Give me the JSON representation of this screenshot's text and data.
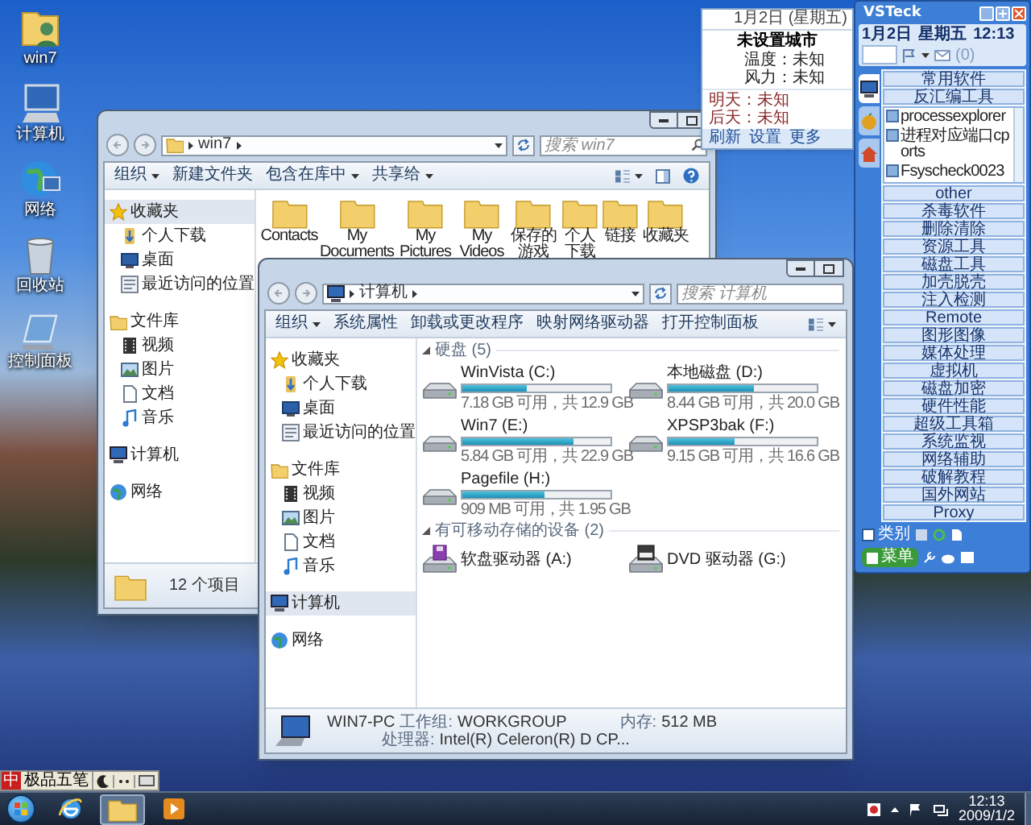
{
  "desktop_icons": [
    {
      "label": "win7",
      "kind": "user"
    },
    {
      "label": "计算机",
      "kind": "computer"
    },
    {
      "label": "网络",
      "kind": "network"
    },
    {
      "label": "回收站",
      "kind": "recycle"
    },
    {
      "label": "控制面板",
      "kind": "control"
    }
  ],
  "folder_window": {
    "breadcrumb": [
      "win7"
    ],
    "search": {
      "placeholder": "搜索 win7"
    },
    "toolbar": [
      {
        "label": "组织",
        "dropdown": true
      },
      {
        "label": "新建文件夹",
        "dropdown": false
      },
      {
        "label": "包含在库中",
        "dropdown": true
      },
      {
        "label": "共享给",
        "dropdown": true
      }
    ],
    "nav": [
      {
        "label": "收藏夹",
        "kind": "star",
        "selected": true,
        "children": [
          {
            "label": "个人下载",
            "kind": "download",
            "selected": false
          },
          {
            "label": "桌面",
            "kind": "desktop",
            "selected": false
          },
          {
            "label": "最近访问的位置",
            "kind": "recent",
            "selected": false
          }
        ]
      },
      {
        "label": "文件库",
        "kind": "library",
        "selected": false,
        "children": [
          {
            "label": "视频",
            "kind": "video",
            "selected": false
          },
          {
            "label": "图片",
            "kind": "picture",
            "selected": false
          },
          {
            "label": "文档",
            "kind": "document",
            "selected": false
          },
          {
            "label": "音乐",
            "kind": "music",
            "selected": false
          }
        ]
      },
      {
        "label": "计算机",
        "kind": "computer",
        "selected": false
      },
      {
        "label": "网络",
        "kind": "network",
        "selected": false
      }
    ],
    "items": [
      {
        "label": "Contacts"
      },
      {
        "label": "My Documents"
      },
      {
        "label": "My Pictures"
      },
      {
        "label": "My Videos"
      },
      {
        "label": "保存的游戏"
      },
      {
        "label": "个人下载"
      },
      {
        "label": "链接"
      },
      {
        "label": "收藏夹"
      }
    ],
    "status": "12 个项目"
  },
  "computer_window": {
    "breadcrumb": [
      "计算机"
    ],
    "search": {
      "placeholder": "搜索 计算机"
    },
    "toolbar": [
      {
        "label": "组织",
        "dropdown": true
      },
      {
        "label": "系统属性",
        "dropdown": false
      },
      {
        "label": "卸载或更改程序",
        "dropdown": false
      },
      {
        "label": "映射网络驱动器",
        "dropdown": false
      },
      {
        "label": "打开控制面板",
        "dropdown": false
      }
    ],
    "nav": [
      {
        "label": "收藏夹",
        "kind": "star",
        "selected": false,
        "children": [
          {
            "label": "个人下载",
            "kind": "download",
            "selected": false
          },
          {
            "label": "桌面",
            "kind": "desktop",
            "selected": false
          },
          {
            "label": "最近访问的位置",
            "kind": "recent",
            "selected": false
          }
        ]
      },
      {
        "label": "文件库",
        "kind": "library",
        "selected": false,
        "children": [
          {
            "label": "视频",
            "kind": "video",
            "selected": false
          },
          {
            "label": "图片",
            "kind": "picture",
            "selected": false
          },
          {
            "label": "文档",
            "kind": "document",
            "selected": false
          },
          {
            "label": "音乐",
            "kind": "music",
            "selected": false
          }
        ]
      },
      {
        "label": "计算机",
        "kind": "computer",
        "selected": true
      },
      {
        "label": "网络",
        "kind": "network",
        "selected": false
      }
    ],
    "groups": [
      {
        "title": "硬盘 (5)",
        "expanded": true,
        "drives": [
          {
            "name": "WinVista (C:)",
            "kind": "disk",
            "level": 0.44,
            "free": "7.18 GB 可用，共 12.9 GB"
          },
          {
            "name": "本地磁盘 (D:)",
            "kind": "disk",
            "level": 0.58,
            "free": "8.44 GB 可用，共 20.0 GB"
          },
          {
            "name": "Win7 (E:)",
            "kind": "disk",
            "level": 0.75,
            "free": "5.84 GB 可用，共 22.9 GB"
          },
          {
            "name": "XPSP3bak (F:)",
            "kind": "disk",
            "level": 0.45,
            "free": "9.15 GB 可用，共 16.6 GB"
          },
          {
            "name": "Pagefile (H:)",
            "kind": "disk",
            "level": 0.55,
            "free": "909 MB 可用，共 1.95 GB"
          }
        ]
      },
      {
        "title": "有可移动存储的设备 (2)",
        "expanded": true,
        "drives": [
          {
            "name": "软盘驱动器 (A:)",
            "kind": "floppy"
          },
          {
            "name": "DVD 驱动器 (G:)",
            "kind": "dvd"
          }
        ]
      }
    ],
    "details": {
      "name": "WIN7-PC",
      "fields": [
        {
          "label": "工作组:",
          "value": "WORKGROUP"
        },
        {
          "label": "内存:",
          "value": "512 MB"
        },
        {
          "label": "处理器:",
          "value": "Intel(R) Celeron(R) D CP..."
        }
      ]
    }
  },
  "weather": {
    "date": "1月2日 (星期五)",
    "city": "未设置城市",
    "today": [
      "温度：未知",
      "风力：未知"
    ],
    "forecast": [
      "明天：未知",
      "后天：未知"
    ],
    "links": [
      "刷新",
      "设置",
      "更多"
    ]
  },
  "vsteck": {
    "title": "VSTeck",
    "date": "1月2日",
    "weekday": "星期五",
    "time": "12:13",
    "mail": "(0)",
    "side_tabs": [
      {
        "kind": "computer",
        "selected": true
      },
      {
        "kind": "apple",
        "selected": false
      },
      {
        "kind": "home",
        "selected": false
      }
    ],
    "entries": [
      {
        "kind": "category",
        "label": "常用软件"
      },
      {
        "kind": "category",
        "label": "反汇编工具"
      },
      {
        "kind": "tools",
        "items": [
          {
            "label": "processexplorer"
          },
          {
            "label": "进程对应端口cports"
          },
          {
            "label": "Fsyscheck0023"
          }
        ]
      },
      {
        "kind": "category",
        "label": "other"
      },
      {
        "kind": "category",
        "label": "杀毒软件"
      },
      {
        "kind": "category",
        "label": "删除清除"
      },
      {
        "kind": "category",
        "label": "资源工具"
      },
      {
        "kind": "category",
        "label": "磁盘工具"
      },
      {
        "kind": "category",
        "label": "加壳脱壳"
      },
      {
        "kind": "category",
        "label": "注入检测"
      },
      {
        "kind": "category",
        "label": "Remote"
      },
      {
        "kind": "category",
        "label": "图形图像"
      },
      {
        "kind": "category",
        "label": "媒体处理"
      },
      {
        "kind": "category",
        "label": "虚拟机"
      },
      {
        "kind": "category",
        "label": "磁盘加密"
      },
      {
        "kind": "category",
        "label": "硬件性能"
      },
      {
        "kind": "category",
        "label": "超级工具箱"
      },
      {
        "kind": "category",
        "label": "系统监视"
      },
      {
        "kind": "category",
        "label": "网络辅助"
      },
      {
        "kind": "category",
        "label": "破解教程"
      },
      {
        "kind": "category",
        "label": "国外网站"
      },
      {
        "kind": "category",
        "label": "Proxy"
      }
    ],
    "category_label": "类别",
    "menu_label": "菜单"
  },
  "ime": {
    "mode": "中",
    "name": "极品五笔"
  },
  "taskbar": {
    "buttons": [
      {
        "kind": "ie",
        "active": false
      },
      {
        "kind": "explorer",
        "active": true
      },
      {
        "kind": "media",
        "active": false
      }
    ],
    "clock": {
      "time": "12:13",
      "date": "2009/1/2"
    }
  }
}
